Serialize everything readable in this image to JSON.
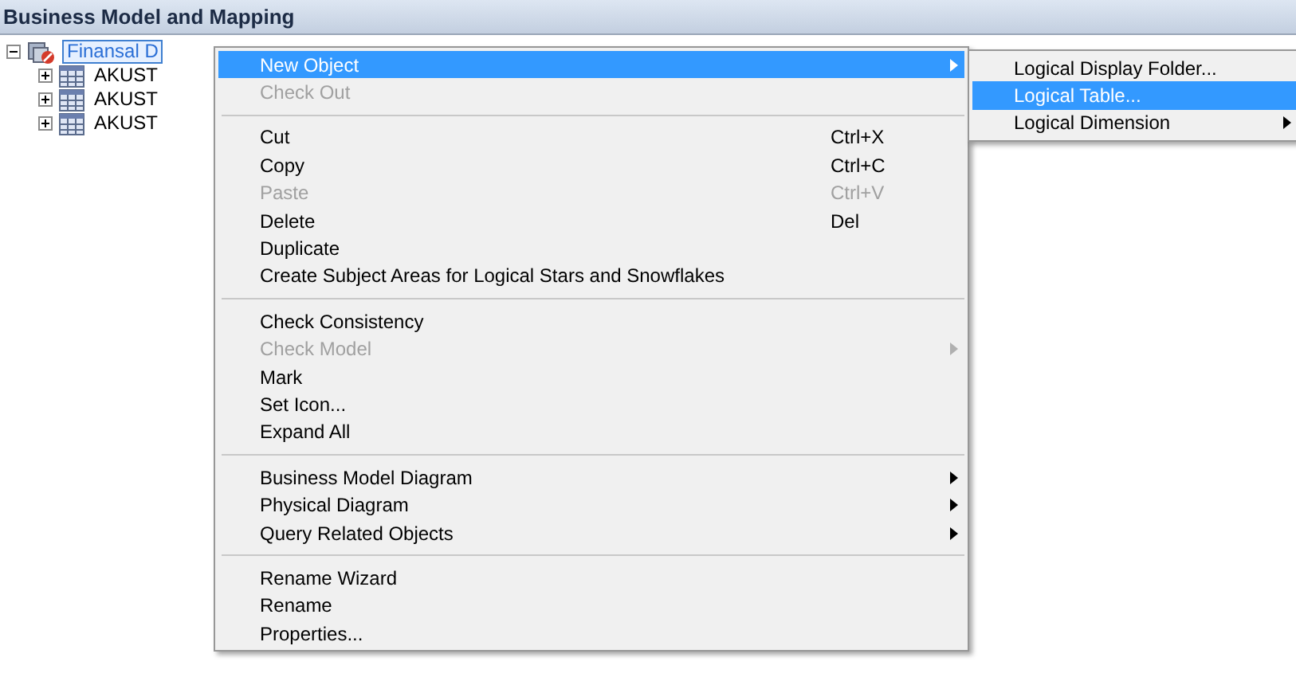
{
  "panel": {
    "title": "Business Model and Mapping"
  },
  "tree": [
    {
      "label": "Finansal D",
      "selected": true,
      "expanded": true,
      "children": [
        {
          "label": "AKUST",
          "selected": false,
          "expanded": false
        },
        {
          "label": "AKUST",
          "selected": false,
          "expanded": false
        },
        {
          "label": "AKUST",
          "selected": false,
          "expanded": false
        }
      ]
    }
  ],
  "context_menu": [
    {
      "kind": "item",
      "label": "New Object",
      "selected": true,
      "submenu": true,
      "disabled": false
    },
    {
      "kind": "item",
      "label": "Check Out",
      "selected": false,
      "submenu": false,
      "disabled": true
    },
    {
      "kind": "separator"
    },
    {
      "kind": "item",
      "label": "Cut",
      "shortcut": "Ctrl+X",
      "selected": false,
      "submenu": false,
      "disabled": false
    },
    {
      "kind": "item",
      "label": "Copy",
      "shortcut": "Ctrl+C",
      "selected": false,
      "submenu": false,
      "disabled": false
    },
    {
      "kind": "item",
      "label": "Paste",
      "shortcut": "Ctrl+V",
      "selected": false,
      "submenu": false,
      "disabled": true
    },
    {
      "kind": "item",
      "label": "Delete",
      "shortcut": "Del",
      "selected": false,
      "submenu": false,
      "disabled": false
    },
    {
      "kind": "item",
      "label": "Duplicate",
      "selected": false,
      "submenu": false,
      "disabled": false
    },
    {
      "kind": "item",
      "label": "Create Subject Areas for Logical Stars and Snowflakes",
      "selected": false,
      "submenu": false,
      "disabled": false
    },
    {
      "kind": "separator"
    },
    {
      "kind": "item",
      "label": "Check Consistency",
      "selected": false,
      "submenu": false,
      "disabled": false
    },
    {
      "kind": "item",
      "label": "Check Model",
      "selected": false,
      "submenu": true,
      "disabled": true
    },
    {
      "kind": "item",
      "label": "Mark",
      "selected": false,
      "submenu": false,
      "disabled": false
    },
    {
      "kind": "item",
      "label": "Set Icon...",
      "selected": false,
      "submenu": false,
      "disabled": false
    },
    {
      "kind": "item",
      "label": "Expand All",
      "selected": false,
      "submenu": false,
      "disabled": false
    },
    {
      "kind": "separator"
    },
    {
      "kind": "item",
      "label": "Business Model Diagram",
      "selected": false,
      "submenu": true,
      "disabled": false
    },
    {
      "kind": "item",
      "label": "Physical Diagram",
      "selected": false,
      "submenu": true,
      "disabled": false
    },
    {
      "kind": "item",
      "label": "Query Related Objects",
      "selected": false,
      "submenu": true,
      "disabled": false
    },
    {
      "kind": "separator"
    },
    {
      "kind": "item",
      "label": "Rename Wizard",
      "selected": false,
      "submenu": false,
      "disabled": false
    },
    {
      "kind": "item",
      "label": "Rename",
      "selected": false,
      "submenu": false,
      "disabled": false
    },
    {
      "kind": "item",
      "label": "Properties...",
      "selected": false,
      "submenu": false,
      "disabled": false
    }
  ],
  "submenu": [
    {
      "label": "Logical Display Folder...",
      "selected": false,
      "submenu": false
    },
    {
      "label": "Logical Table...",
      "selected": true,
      "submenu": false
    },
    {
      "label": "Logical Dimension",
      "selected": false,
      "submenu": true
    }
  ]
}
